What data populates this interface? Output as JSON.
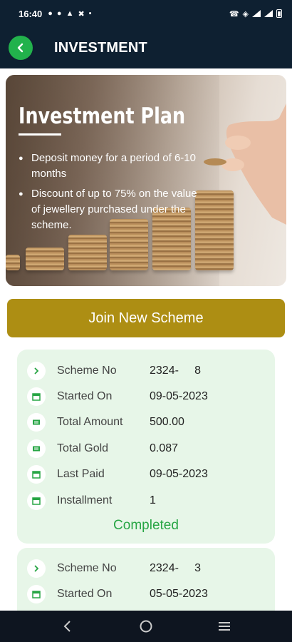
{
  "status_bar": {
    "time": "16:40",
    "notification_icons": [
      "chat-bubble-icon",
      "chat-bubble-icon",
      "bell-icon",
      "pinwheel-icon",
      "dot-icon"
    ],
    "system_icons": [
      "wifi-call-icon",
      "wifi-icon",
      "signal-icon",
      "signal-icon",
      "battery-icon"
    ]
  },
  "app_bar": {
    "title": "INVESTMENT",
    "back_icon": "chevron-left-icon",
    "accent_color": "#22b24c",
    "background_color": "#0e2031"
  },
  "banner": {
    "title": "Investment Plan",
    "bullets": [
      "Deposit money for a period of 6-10 months",
      "Discount of up to 75% on the value of jewellery purchased under the scheme."
    ]
  },
  "join_button": {
    "label": "Join New Scheme",
    "color": "#ad8e13"
  },
  "schemes": [
    {
      "rows": [
        {
          "icon": "chevron-right-icon",
          "label": "Scheme No",
          "value": "2324-     8"
        },
        {
          "icon": "calendar-icon",
          "label": "Started On",
          "value": "09-05-2023"
        },
        {
          "icon": "money-icon",
          "label": "Total Amount",
          "value": "500.00"
        },
        {
          "icon": "money-icon",
          "label": "Total Gold",
          "value": "0.087"
        },
        {
          "icon": "calendar-icon",
          "label": "Last Paid",
          "value": "09-05-2023"
        },
        {
          "icon": "calendar-icon",
          "label": "Installment",
          "value": "1"
        }
      ],
      "status": "Completed",
      "status_color": "#27a544"
    },
    {
      "rows": [
        {
          "icon": "chevron-right-icon",
          "label": "Scheme No",
          "value": "2324-     3"
        },
        {
          "icon": "calendar-icon",
          "label": "Started On",
          "value": "05-05-2023"
        }
      ]
    }
  ],
  "nav_bar": {
    "buttons": [
      "back-nav-icon",
      "home-nav-icon",
      "recents-nav-icon"
    ]
  }
}
